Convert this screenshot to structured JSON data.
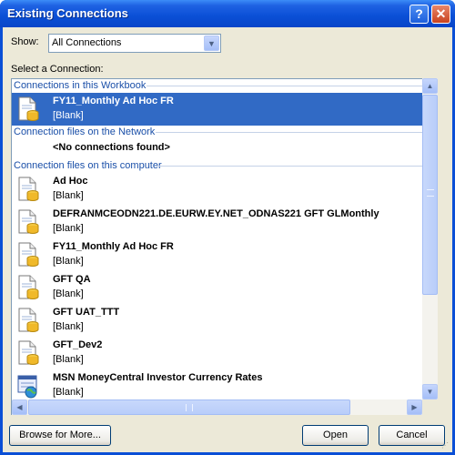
{
  "window": {
    "title": "Existing Connections",
    "help_glyph": "?",
    "close_glyph": "✕"
  },
  "show": {
    "label": "Show:",
    "selected": "All Connections"
  },
  "list": {
    "label": "Select a Connection:",
    "groups": [
      {
        "header": "Connections in this Workbook",
        "items": [
          {
            "name": "FY11_Monthly Ad Hoc FR",
            "desc": "[Blank]",
            "selected": true,
            "icon": "data-connection-icon"
          }
        ]
      },
      {
        "header": "Connection files on the Network",
        "empty_text": "<No connections found>"
      },
      {
        "header": "Connection files on this computer",
        "items": [
          {
            "name": "Ad Hoc",
            "desc": "[Blank]",
            "icon": "data-connection-icon"
          },
          {
            "name": "DEFRANMCEODN221.DE.EURW.EY.NET_ODNAS221 GFT GLMonthly",
            "desc": "[Blank]",
            "icon": "data-connection-icon"
          },
          {
            "name": "FY11_Monthly Ad Hoc FR",
            "desc": "[Blank]",
            "icon": "data-connection-icon"
          },
          {
            "name": "GFT QA",
            "desc": "[Blank]",
            "icon": "data-connection-icon"
          },
          {
            "name": "GFT UAT_TTT",
            "desc": "[Blank]",
            "icon": "data-connection-icon"
          },
          {
            "name": "GFT_Dev2",
            "desc": "[Blank]",
            "icon": "data-connection-icon"
          },
          {
            "name": "MSN MoneyCentral Investor Currency Rates",
            "desc": "[Blank]",
            "icon": "web-query-icon"
          }
        ]
      }
    ]
  },
  "buttons": {
    "browse": "Browse for More...",
    "open": "Open",
    "cancel": "Cancel"
  },
  "colors": {
    "title_bar": "#0a4fd6",
    "selection": "#316ac5",
    "group_header": "#1a4fa8",
    "dialog_bg": "#ece9d8"
  }
}
